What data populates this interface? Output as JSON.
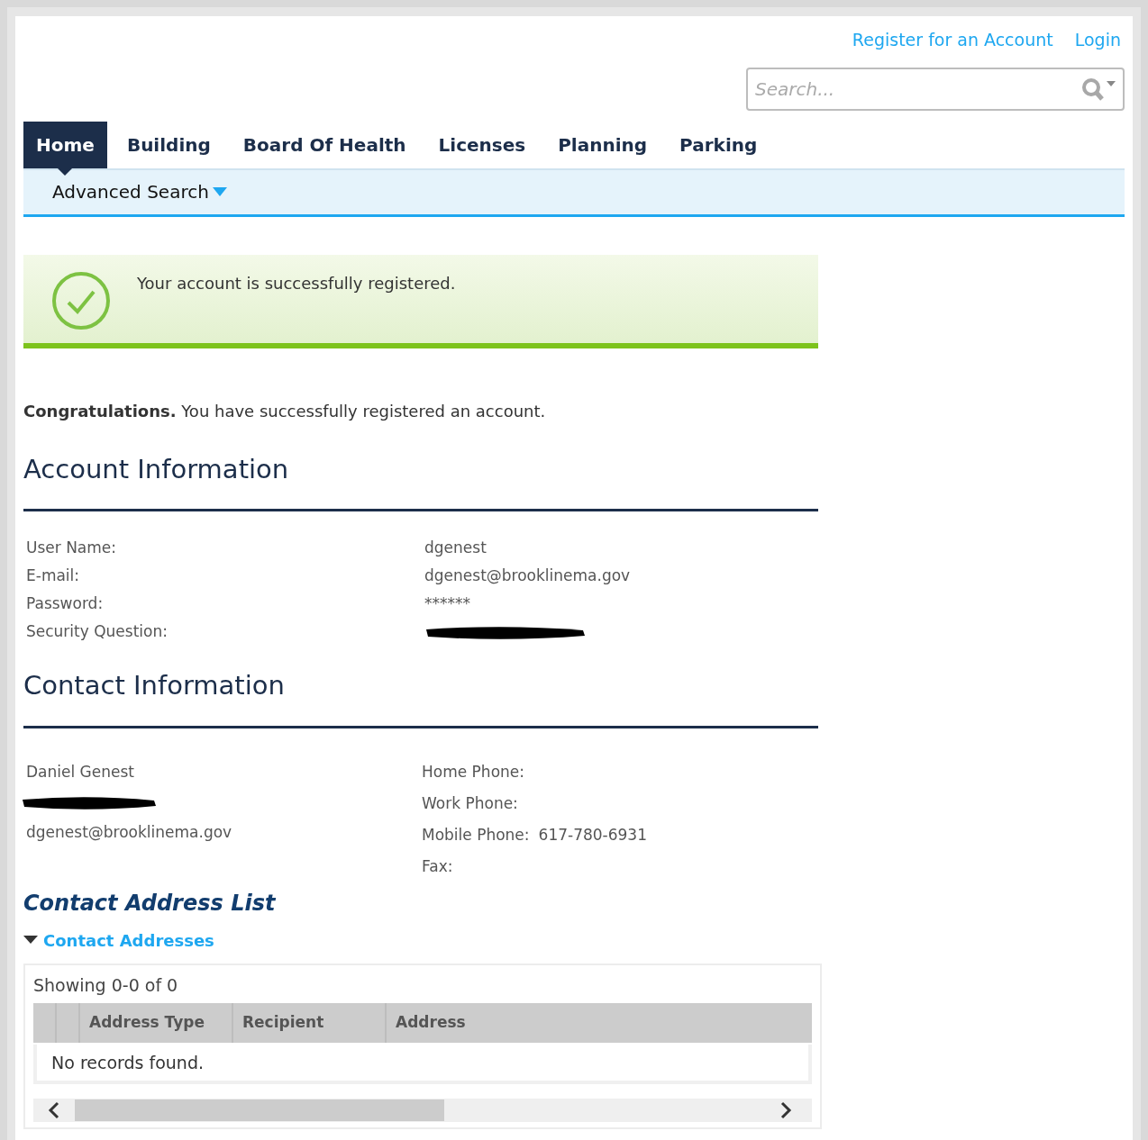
{
  "header_links": [
    "Register for an Account",
    "Login"
  ],
  "search": {
    "placeholder": "Search..."
  },
  "tabs": [
    {
      "label": "Home",
      "selected": true
    },
    {
      "label": "Building",
      "selected": false
    },
    {
      "label": "Board Of Health",
      "selected": false
    },
    {
      "label": "Licenses",
      "selected": false
    },
    {
      "label": "Planning",
      "selected": false
    },
    {
      "label": "Parking",
      "selected": false
    }
  ],
  "subnav": {
    "label": "Advanced Search"
  },
  "notice": {
    "message": "Your account is successfully registered."
  },
  "intro": "**Congratulations.** You have successfully registered an account.",
  "account": {
    "title": "Account Information",
    "fields": [
      {
        "label": "User Name:",
        "value": "dgenest"
      },
      {
        "label": "E-mail:",
        "value": "dgenest@brooklinema.gov"
      },
      {
        "label": "Password:",
        "value": "******"
      },
      {
        "label": "Security Question:",
        "redacted": true
      }
    ]
  },
  "contact": {
    "title": "Contact Information",
    "name": "Daniel Genest",
    "address_redacted": true,
    "email": "dgenest@brooklinema.gov",
    "phones": [
      {
        "label": "Home Phone:"
      },
      {
        "label": "Work Phone:"
      },
      {
        "label": "Mobile Phone:",
        "value": "617-780-6931"
      },
      {
        "label": "Fax:"
      }
    ]
  },
  "address_list": {
    "title": "Contact Address List",
    "section": {
      "label": "Contact Addresses",
      "expanded": true
    },
    "showing": "Showing 0-0 of 0",
    "columns": [
      "Address Type",
      "Recipient",
      "Address"
    ],
    "empty_message": "No records found."
  }
}
